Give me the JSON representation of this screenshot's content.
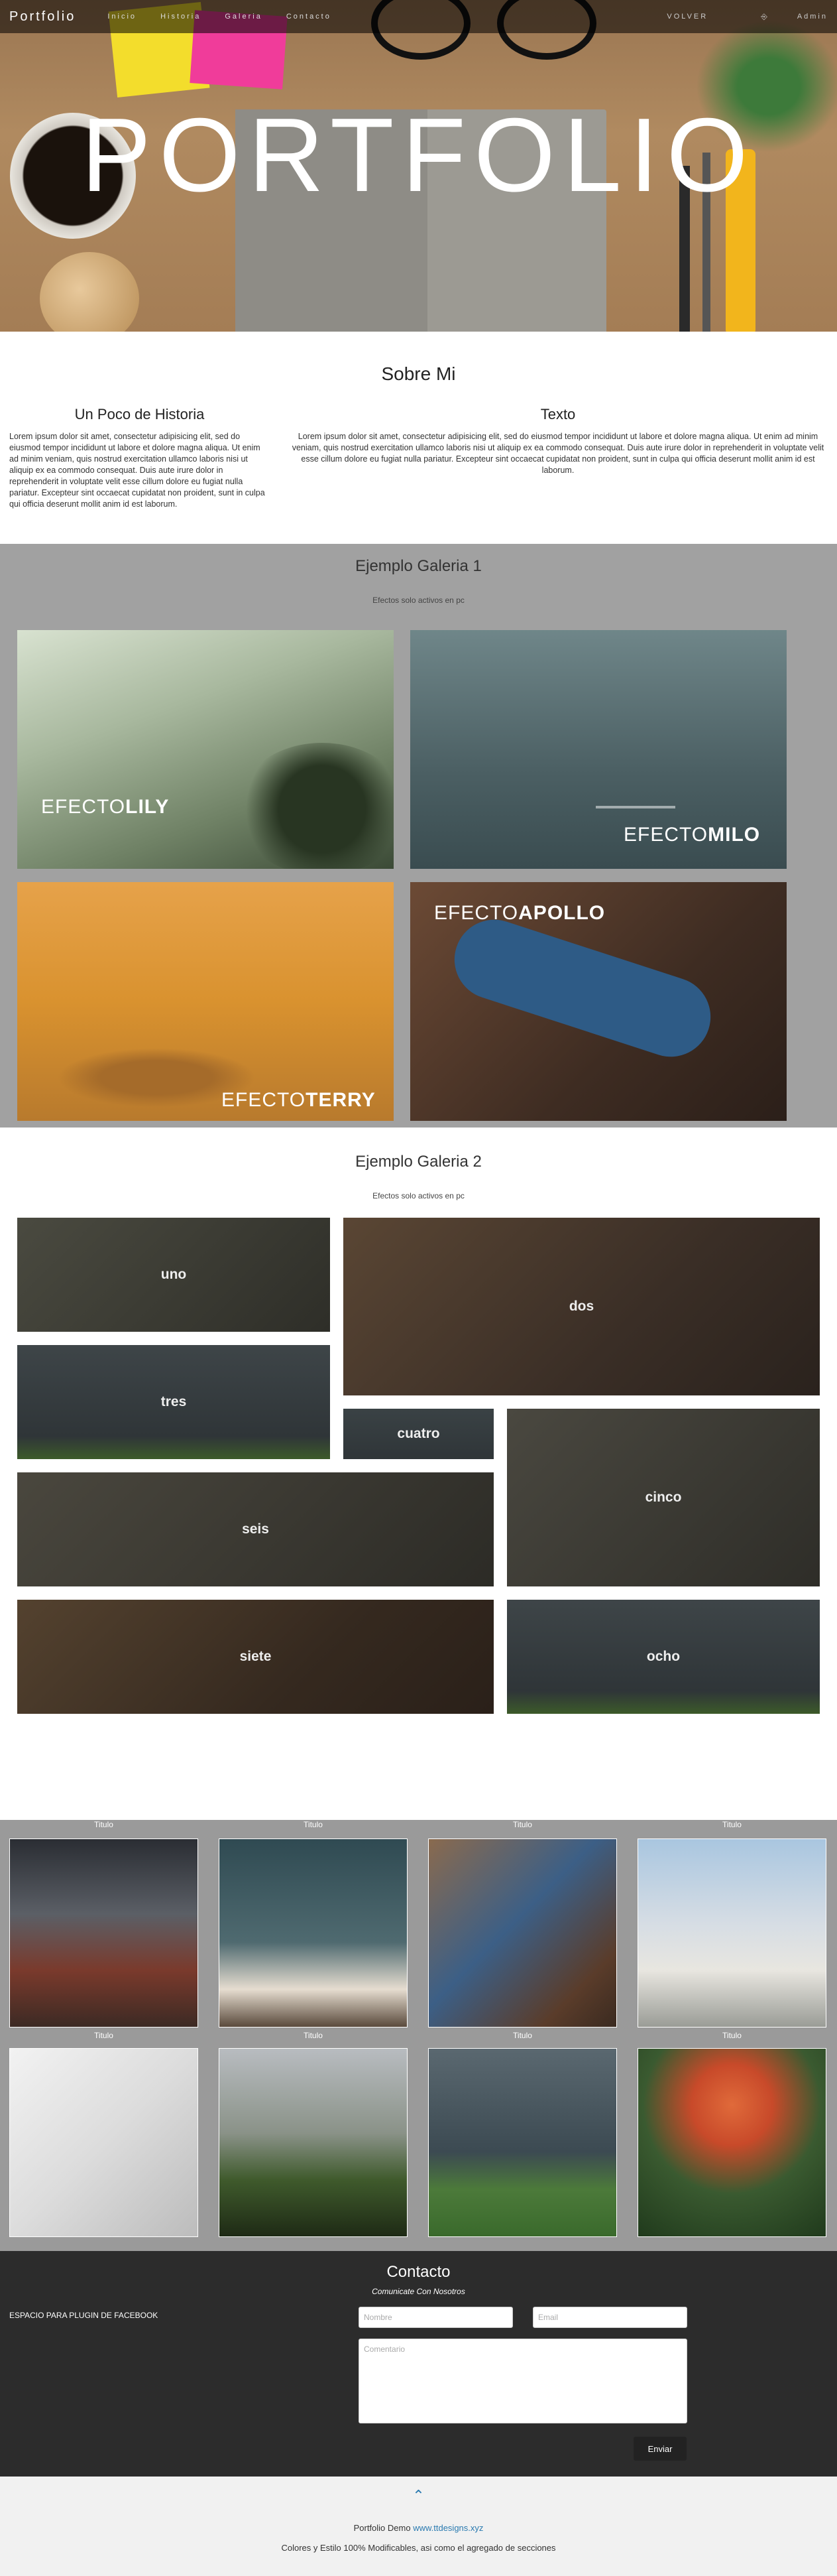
{
  "nav": {
    "brand": "Portfolio",
    "links": [
      "Inicio",
      "Historia",
      "Galeria",
      "Contacto"
    ],
    "volver": "VOLVER",
    "admin": "Admin"
  },
  "hero": {
    "title": "PORTFOLIO"
  },
  "about": {
    "title": "Sobre Mi",
    "col1_title": "Un Poco de Historia",
    "col1_text": "Lorem ipsum dolor sit amet, consectetur adipisicing elit, sed do eiusmod tempor incididunt ut labore et dolore magna aliqua. Ut enim ad minim veniam, quis nostrud exercitation ullamco laboris nisi ut aliquip ex ea commodo consequat. Duis aute irure dolor in reprehenderit in voluptate velit esse cillum dolore eu fugiat nulla pariatur. Excepteur sint occaecat cupidatat non proident, sunt in culpa qui officia deserunt mollit anim id est laborum.",
    "col2_title": "Texto",
    "col2_text": "Lorem ipsum dolor sit amet, consectetur adipisicing elit, sed do eiusmod tempor incididunt ut labore et dolore magna aliqua. Ut enim ad minim veniam, quis nostrud exercitation ullamco laboris nisi ut aliquip ex ea commodo consequat. Duis aute irure dolor in reprehenderit in voluptate velit esse cillum dolore eu fugiat nulla pariatur. Excepteur sint occaecat cupidatat non proident, sunt in culpa qui officia deserunt mollit anim id est laborum."
  },
  "gallery1": {
    "title": "Ejemplo Galeria 1",
    "subtitle": "Efectos solo activos en pc",
    "items": [
      {
        "pre": "EFECTO",
        "name": "LILY"
      },
      {
        "pre": "EFECTO",
        "name": "MILO"
      },
      {
        "pre": "EFECTO",
        "name": "TERRY"
      },
      {
        "pre": "EFECTO",
        "name": "APOLLO"
      }
    ]
  },
  "gallery2": {
    "title": "Ejemplo Galeria 2",
    "subtitle": "Efectos solo activos en pc",
    "labels": [
      "uno",
      "dos",
      "tres",
      "cuatro",
      "cinco",
      "seis",
      "siete",
      "ocho"
    ]
  },
  "grid": {
    "captions": [
      "Titulo",
      "Titulo",
      "Titulo",
      "Titulo",
      "Titulo",
      "Titulo",
      "Titulo",
      "Titulo"
    ]
  },
  "contact": {
    "title": "Contacto",
    "subtitle": "Comunicate Con Nosotros",
    "facebook": "ESPACIO PARA PLUGIN DE FACEBOOK",
    "name_placeholder": "Nombre",
    "email_placeholder": "Email",
    "comment_placeholder": "Comentario",
    "send": "Enviar"
  },
  "footer": {
    "up_icon": "chevron-up",
    "line1_prefix": "Portfolio Demo ",
    "line1_link": "www.ttdesigns.xyz",
    "line2": "Colores y Estilo 100% Modificables, asi como el agregado de secciones"
  },
  "colors": {
    "accent": "#2a7ab0",
    "dark": "#2c2c2c",
    "gray": "#a1a1a1"
  }
}
